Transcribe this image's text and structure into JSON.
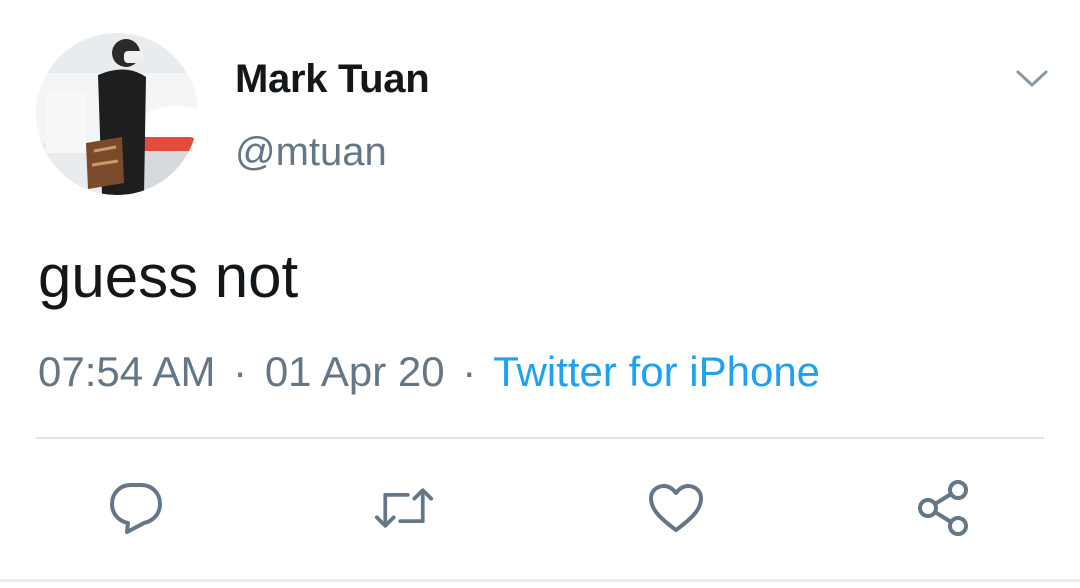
{
  "tweet": {
    "display_name": "Mark Tuan",
    "handle": "@mtuan",
    "text": "guess not",
    "time": "07:54 AM",
    "separator": "·",
    "date": "01 Apr 20",
    "source": "Twitter for iPhone"
  },
  "colors": {
    "text_primary": "#14171a",
    "text_secondary": "#657786",
    "link": "#1da1f2",
    "divider": "#dfe4e8"
  },
  "icons": {
    "caret": "chevron-down-icon",
    "reply": "reply-icon",
    "retweet": "retweet-icon",
    "like": "heart-icon",
    "share": "share-icon"
  }
}
